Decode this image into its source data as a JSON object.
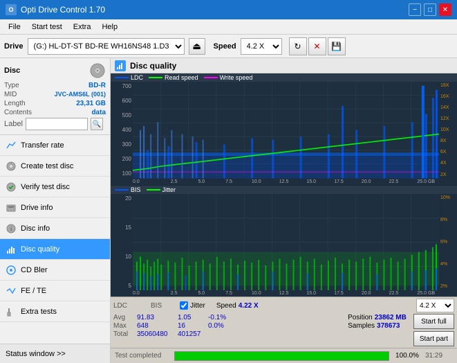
{
  "titleBar": {
    "title": "Opti Drive Control 1.70",
    "icon": "O",
    "minimizeLabel": "−",
    "maximizeLabel": "□",
    "closeLabel": "✕"
  },
  "menuBar": {
    "items": [
      "File",
      "Start test",
      "Extra",
      "Help"
    ]
  },
  "driveBar": {
    "label": "Drive",
    "driveValue": "(G:)  HL-DT-ST BD-RE  WH16NS48 1.D3",
    "speedLabel": "Speed",
    "speedValue": "4.2 X"
  },
  "disc": {
    "title": "Disc",
    "typeLabel": "Type",
    "typeValue": "BD-R",
    "midLabel": "MID",
    "midValue": "JVC-AMS6L (001)",
    "lengthLabel": "Length",
    "lengthValue": "23,31 GB",
    "contentsLabel": "Contents",
    "contentsValue": "data",
    "labelLabel": "Label",
    "labelValue": ""
  },
  "nav": {
    "items": [
      {
        "id": "transfer-rate",
        "label": "Transfer rate",
        "icon": "📈"
      },
      {
        "id": "create-test-disc",
        "label": "Create test disc",
        "icon": "💿"
      },
      {
        "id": "verify-test-disc",
        "label": "Verify test disc",
        "icon": "✔"
      },
      {
        "id": "drive-info",
        "label": "Drive info",
        "icon": "ℹ"
      },
      {
        "id": "disc-info",
        "label": "Disc info",
        "icon": "📋"
      },
      {
        "id": "disc-quality",
        "label": "Disc quality",
        "icon": "📊",
        "active": true
      },
      {
        "id": "cd-bler",
        "label": "CD Bler",
        "icon": "🔵"
      },
      {
        "id": "fe-te",
        "label": "FE / TE",
        "icon": "📉"
      },
      {
        "id": "extra-tests",
        "label": "Extra tests",
        "icon": "🔬"
      }
    ]
  },
  "statusWindow": {
    "label": "Status window >>",
    "text": "Test completed"
  },
  "discQuality": {
    "title": "Disc quality",
    "legend": {
      "ldc": "LDC",
      "readSpeed": "Read speed",
      "writeSpeed": "Write speed",
      "bis": "BIS",
      "jitter": "Jitter"
    }
  },
  "topChart": {
    "yLabels": [
      "700",
      "600",
      "500",
      "400",
      "300",
      "200",
      "100"
    ],
    "yLabelsRight": [
      "18X",
      "16X",
      "14X",
      "12X",
      "10X",
      "8X",
      "6X",
      "4X",
      "2X"
    ],
    "xLabels": [
      "0.0",
      "2.5",
      "5.0",
      "7.5",
      "10.0",
      "12.5",
      "15.0",
      "17.5",
      "20.0",
      "22.5",
      "25.0 GB"
    ]
  },
  "bottomChart": {
    "yLabels": [
      "20",
      "15",
      "10",
      "5"
    ],
    "yLabelsRight": [
      "10%",
      "8%",
      "6%",
      "4%",
      "2%"
    ],
    "xLabels": [
      "0.0",
      "2.5",
      "5.0",
      "7.5",
      "10.0",
      "12.5",
      "15.0",
      "17.5",
      "20.0",
      "22.5",
      "25.0 GB"
    ]
  },
  "stats": {
    "ldcLabel": "LDC",
    "bisLabel": "BIS",
    "jitterChecked": true,
    "jitterLabel": "Jitter",
    "speedLabel": "Speed",
    "speedValue": "4.22 X",
    "positionLabel": "Position",
    "positionValue": "23862 MB",
    "samplesLabel": "Samples",
    "samplesValue": "378673",
    "avgLabel": "Avg",
    "avgLdc": "91.83",
    "avgBis": "1.05",
    "avgJitter": "-0.1%",
    "maxLabel": "Max",
    "maxLdc": "648",
    "maxBis": "16",
    "maxJitter": "0.0%",
    "totalLabel": "Total",
    "totalLdc": "35060480",
    "totalBis": "401257",
    "totalJitter": ""
  },
  "speedSelector": {
    "value": "4.2 X"
  },
  "buttons": {
    "startFull": "Start full",
    "startPart": "Start part"
  },
  "progress": {
    "statusText": "Test completed",
    "percentage": "100.0%",
    "fillPercent": 100,
    "time": "31:29"
  },
  "colors": {
    "ldc": "#0066ff",
    "readSpeed": "#00ff00",
    "writeSpeed": "#ff00ff",
    "bis": "#0066ff",
    "jitter": "#00ff00",
    "chartBg": "#1e3040",
    "progressFill": "#00cc00"
  }
}
